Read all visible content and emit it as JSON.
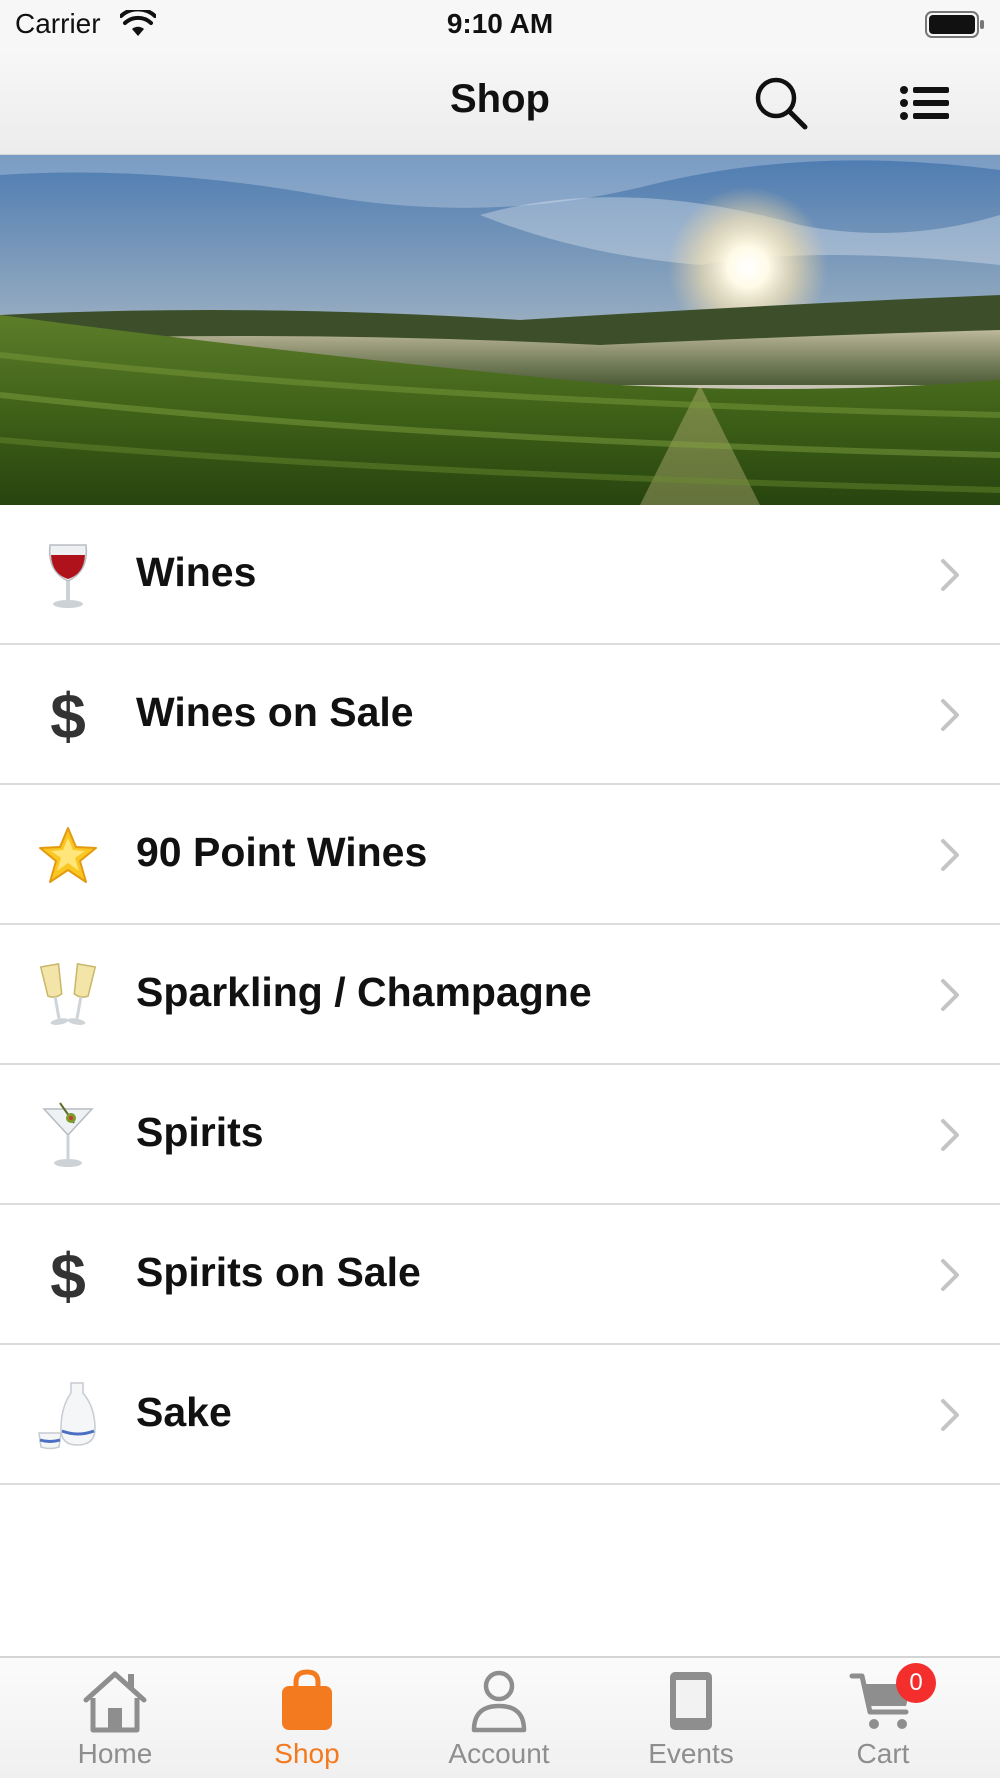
{
  "status_bar": {
    "carrier": "Carrier",
    "time": "9:10 AM",
    "wifi_icon": "wifi-icon",
    "battery_icon": "battery-icon"
  },
  "nav": {
    "title": "Shop",
    "search_icon": "search-icon",
    "menu_icon": "list-menu-icon"
  },
  "hero": {
    "image": "vineyard-sunrise-photo"
  },
  "categories": [
    {
      "label": "Wines",
      "icon": "wine-glass-icon"
    },
    {
      "label": "Wines on Sale",
      "icon": "dollar-sign-icon"
    },
    {
      "label": "90 Point Wines",
      "icon": "star-icon"
    },
    {
      "label": "Sparkling / Champagne",
      "icon": "champagne-glasses-icon"
    },
    {
      "label": "Spirits",
      "icon": "cocktail-glass-icon"
    },
    {
      "label": "Spirits on Sale",
      "icon": "dollar-sign-icon"
    },
    {
      "label": "Sake",
      "icon": "sake-bottle-icon"
    }
  ],
  "tabs": [
    {
      "label": "Home",
      "icon": "home-icon",
      "active": false
    },
    {
      "label": "Shop",
      "icon": "shopping-bag-icon",
      "active": true
    },
    {
      "label": "Account",
      "icon": "person-icon",
      "active": false
    },
    {
      "label": "Events",
      "icon": "calendar-icon",
      "active": false
    },
    {
      "label": "Cart",
      "icon": "cart-icon",
      "active": false
    }
  ],
  "cart": {
    "badge_count": "0"
  },
  "colors": {
    "accent": "#f47a1f",
    "tab_inactive": "#8e8e8e",
    "badge": "#f42d2d",
    "chevron": "#c4c4c4"
  }
}
